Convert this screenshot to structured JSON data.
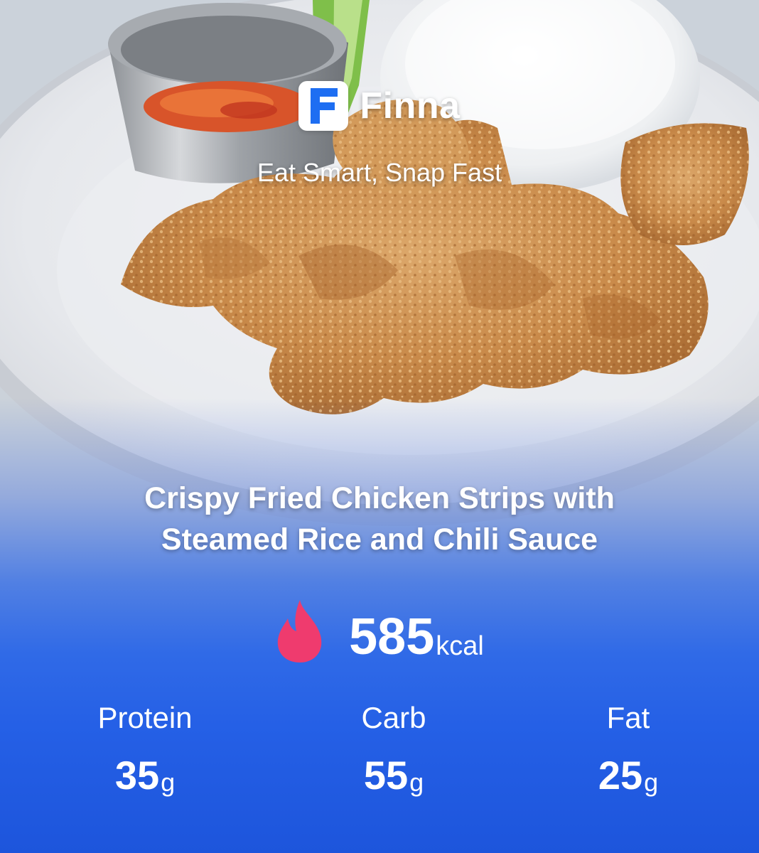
{
  "brand": {
    "logo_letter": "F",
    "name": "Finna",
    "tagline": "Eat Smart, Snap Fast"
  },
  "dish": {
    "title_line1": "Crispy Fried Chicken Strips with",
    "title_line2": "Steamed Rice and Chili Sauce"
  },
  "calories": {
    "value": "585",
    "unit": "kcal",
    "icon": "flame-icon"
  },
  "macros": {
    "protein": {
      "label": "Protein",
      "value": "35",
      "unit": "g"
    },
    "carb": {
      "label": "Carb",
      "value": "55",
      "unit": "g"
    },
    "fat": {
      "label": "Fat",
      "value": "25",
      "unit": "g"
    }
  },
  "colors": {
    "accent_blue": "#2560e6",
    "logo_blue": "#1e6ef2",
    "flame_pink": "#ef3b6e"
  }
}
